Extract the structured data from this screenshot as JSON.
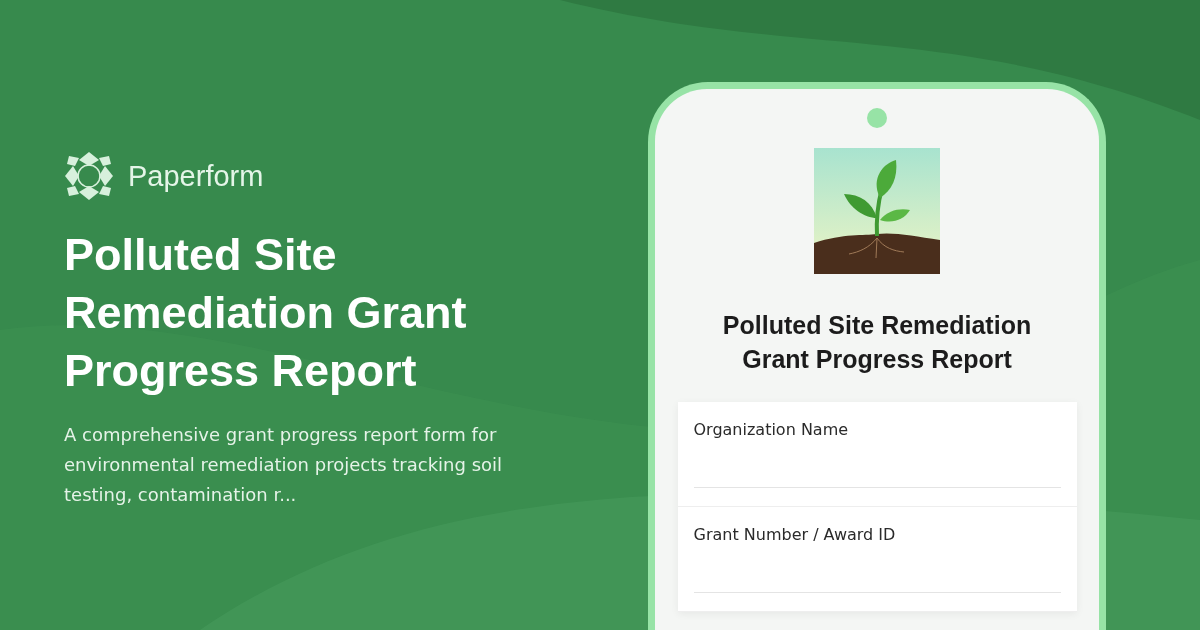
{
  "brand": {
    "name": "Paperform"
  },
  "headline": "Polluted Site Remediation Grant Progress Report",
  "description": "A comprehensive grant progress report form for environmental remediation projects tracking soil testing, contamination r...",
  "phone": {
    "form_title": "Polluted Site Remediation Grant Progress Report",
    "fields": [
      {
        "label": "Organization Name"
      },
      {
        "label": "Grant Number / Award ID"
      }
    ]
  }
}
